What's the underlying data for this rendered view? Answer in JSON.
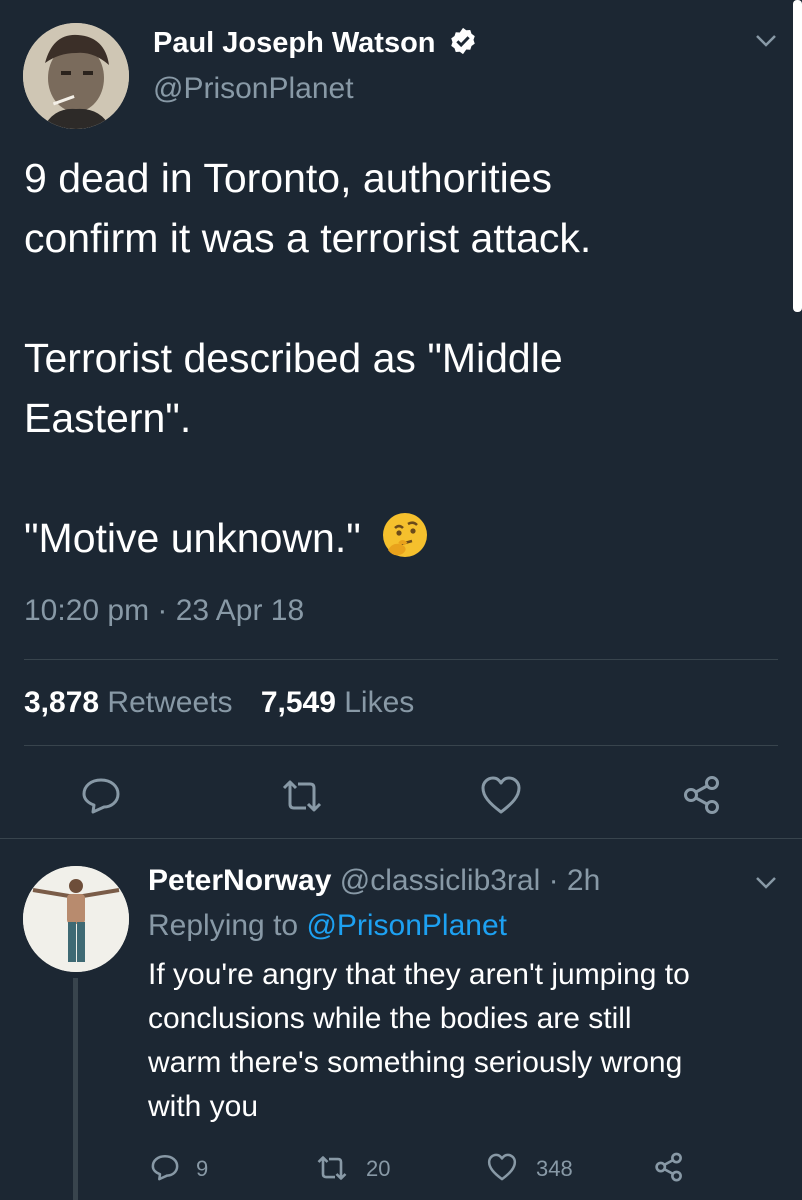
{
  "colors": {
    "background": "#1c2733",
    "text": "#ffffff",
    "muted": "#8899a6",
    "link": "#1da1f2",
    "divider": "#38444d",
    "emoji": "#f5c02d"
  },
  "main_tweet": {
    "author_name": "Paul Joseph Watson",
    "handle": "@PrisonPlanet",
    "verified_icon": "verified-badge-icon",
    "text_lines": [
      "9 dead in Toronto, authorities",
      "confirm it was a terrorist attack.",
      "Terrorist described as \"Middle",
      "Eastern\".",
      "\"Motive unknown.\""
    ],
    "emoji": "thinking-face-emoji",
    "timestamp": "10:20 pm · 23 Apr 18",
    "retweets_count": "3,878",
    "retweets_label": "Retweets",
    "likes_count": "7,549",
    "likes_label": "Likes",
    "actions": [
      "reply-icon",
      "retweet-icon",
      "like-icon",
      "share-icon"
    ]
  },
  "reply": {
    "author_name": "PeterNorway",
    "handle_time": "@classiclib3ral · 2h",
    "replying_to_label": "Replying to",
    "replying_to_handle": "@PrisonPlanet",
    "text_lines": [
      "If you're angry that they aren't jumping to",
      "conclusions while the bodies are still",
      "warm there's something seriously wrong",
      "with you"
    ],
    "reply_count": "9",
    "retweet_count": "20",
    "like_count": "348"
  }
}
